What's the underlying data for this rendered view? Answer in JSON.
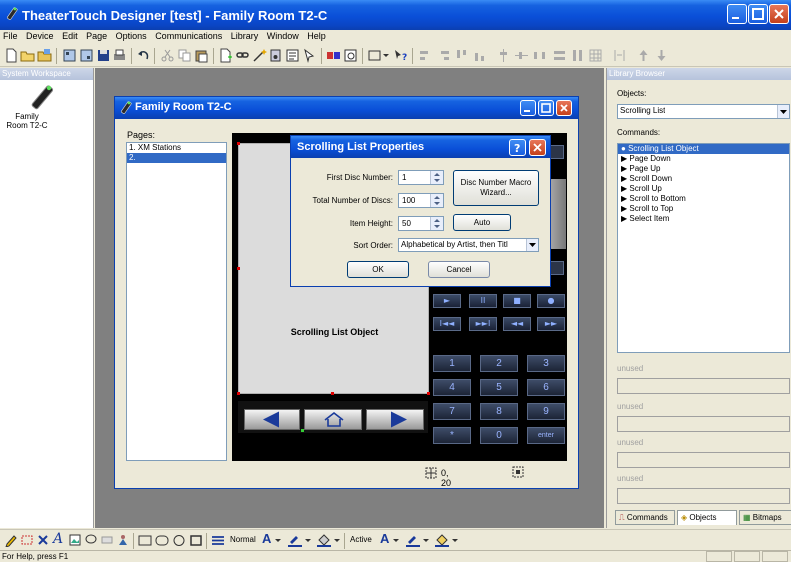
{
  "app": {
    "title": "TheaterTouch Designer [test] - Family Room T2-C"
  },
  "menu": [
    "File",
    "Device",
    "Edit",
    "Page",
    "Options",
    "Communications",
    "Library",
    "Window",
    "Help"
  ],
  "workspace": {
    "header": "System Workspace",
    "device_label": "Family Room T2-C"
  },
  "child_window": {
    "title": "Family Room T2-C",
    "pages_label": "Pages:",
    "pages": [
      "1. XM Stations",
      "2."
    ],
    "selected_page_index": 1,
    "canvas_object_label": "Scrolling List Object",
    "coords": "0, 20",
    "transport_buttons": [
      "►",
      "II",
      "■",
      "●",
      "I◄◄",
      "►►I",
      "◄◄",
      "►►"
    ],
    "keypad": [
      "1",
      "2",
      "3",
      "4",
      "5",
      "6",
      "7",
      "8",
      "9",
      "*",
      "0",
      "enter"
    ]
  },
  "dialog": {
    "title": "Scrolling List Properties",
    "first_disc_label": "First Disc Number:",
    "first_disc_value": "1",
    "total_discs_label": "Total Number of Discs:",
    "total_discs_value": "100",
    "item_height_label": "Item Height:",
    "item_height_value": "50",
    "sort_order_label": "Sort Order:",
    "sort_order_value": "Alphabetical by Artist, then Titl",
    "macro_button": "Disc Number Macro Wizard...",
    "auto_button": "Auto",
    "ok_button": "OK",
    "cancel_button": "Cancel"
  },
  "library": {
    "header": "Library Browser",
    "objects_label": "Objects:",
    "objects_value": "Scrolling List",
    "commands_label": "Commands:",
    "commands": [
      "Scrolling List Object",
      "Page Down",
      "Page Up",
      "Scroll Down",
      "Scroll Up",
      "Scroll to Bottom",
      "Scroll to Top",
      "Select Item"
    ],
    "unused_label": "unused",
    "tabs": [
      "Commands",
      "Objects",
      "Bitmaps"
    ],
    "active_tab": "Objects"
  },
  "bottom_toolbar": {
    "normal_label": "Normal",
    "active_label": "Active"
  },
  "status": {
    "text": "For Help, press F1"
  },
  "colors": {
    "title_blue": "#0a4fd8",
    "selection_blue": "#316ac5",
    "close_red": "#c4401b"
  }
}
